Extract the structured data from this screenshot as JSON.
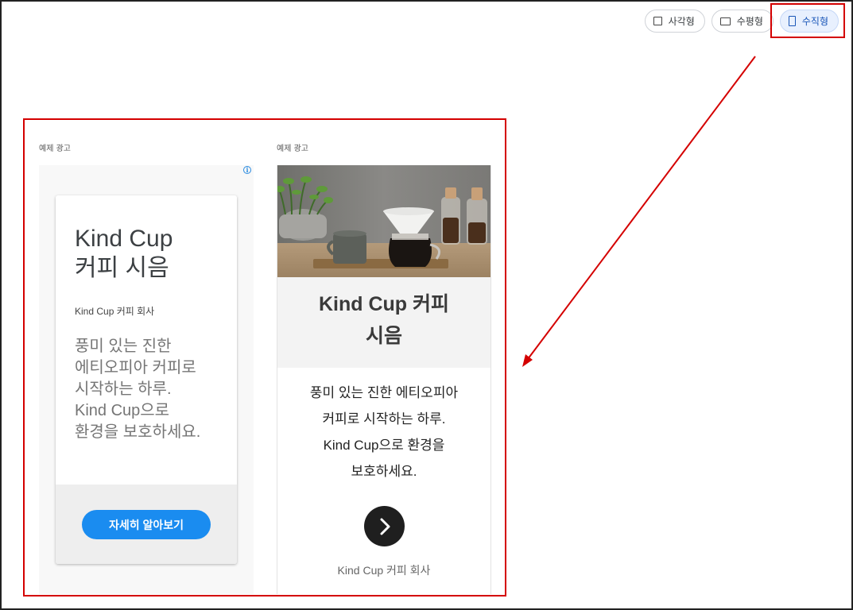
{
  "format_toggle": {
    "options": [
      {
        "label": "사각형",
        "icon": "square-icon",
        "active": false
      },
      {
        "label": "수평형",
        "icon": "horizontal-rect-icon",
        "active": false
      },
      {
        "label": "수직형",
        "icon": "vertical-rect-icon",
        "active": true
      }
    ]
  },
  "ads": [
    {
      "caption": "예제 광고",
      "title_line1": "Kind Cup",
      "title_line2": "커피 시음",
      "company": "Kind Cup 커피 회사",
      "description_lines": [
        "풍미 있는 진한",
        "에티오피아 커피로",
        "시작하는 하루.",
        "Kind Cup으로",
        "환경을 보호하세요."
      ],
      "cta": "자세히 알아보기",
      "info_icon": "info-icon"
    },
    {
      "caption": "예제 광고",
      "title_line1": "Kind Cup 커피",
      "title_line2": "시음",
      "description_lines": [
        "풍미 있는 진한 에티오피아",
        "커피로 시작하는 하루.",
        "Kind Cup으로 환경을",
        "보호하세요."
      ],
      "company": "Kind Cup 커피 회사",
      "next_icon": "chevron-right-icon"
    }
  ],
  "colors": {
    "annotation_red": "#d40000",
    "cta_blue": "#1a8cf0",
    "active_toggle_bg": "#e8f0fe"
  }
}
